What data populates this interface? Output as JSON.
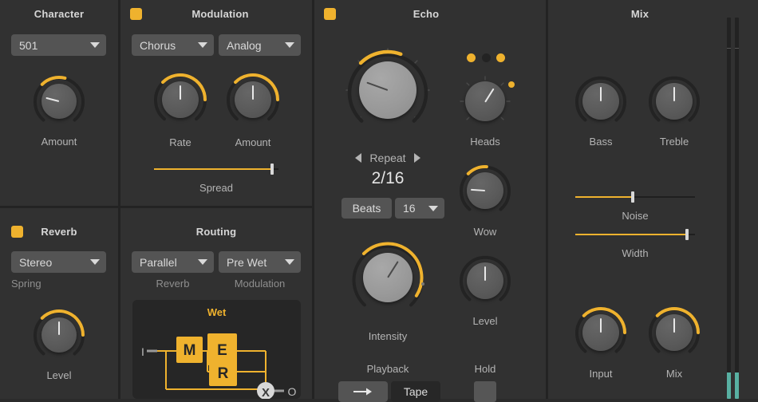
{
  "theme": {
    "background": "#313131",
    "divider": "#232323",
    "accent": "#efb22e",
    "meter": "#58b0a2",
    "knob_cap": "#5a5a5a",
    "text": "#c8c8c8"
  },
  "character": {
    "title": "Character",
    "model_select": {
      "value": "501"
    },
    "amount_knob": {
      "label": "Amount",
      "value": 0.22
    }
  },
  "modulation": {
    "title": "Modulation",
    "enabled": true,
    "type_select": {
      "value": "Chorus"
    },
    "mode_select": {
      "value": "Analog"
    },
    "rate_knob": {
      "label": "Rate",
      "value": 0.5
    },
    "amount_knob": {
      "label": "Amount",
      "value": 0.5
    },
    "spread_slider": {
      "label": "Spread",
      "value": 0.95
    }
  },
  "reverb": {
    "title": "Reverb",
    "enabled": true,
    "mode_select": {
      "value": "Stereo"
    },
    "type_label": "Spring",
    "level_knob": {
      "label": "Level",
      "value": 0.5
    }
  },
  "routing": {
    "title": "Routing",
    "reverb_select": {
      "value": "Parallel"
    },
    "reverb_caption": "Reverb",
    "modulation_select": {
      "value": "Pre Wet"
    },
    "modulation_caption": "Modulation",
    "graph": {
      "title": "Wet",
      "input_label": "I",
      "output_label": "O",
      "nodes": [
        {
          "id": "M",
          "label": "M"
        },
        {
          "id": "E",
          "label": "E"
        },
        {
          "id": "R",
          "label": "R"
        }
      ],
      "mix_node_label": "X"
    }
  },
  "echo": {
    "title": "Echo",
    "enabled": true,
    "time_knob": {
      "value": 0.24
    },
    "repeat_stepper": {
      "label": "Repeat",
      "prev_icon": "triangle-left-icon",
      "next_icon": "triangle-right-icon"
    },
    "time_value": "2/16",
    "beats_button": {
      "label": "Beats"
    },
    "division_select": {
      "value": "16"
    },
    "heads_knob": {
      "label": "Heads",
      "value": 0.62
    },
    "head_leds": [
      "on",
      "off",
      "on"
    ],
    "wow_knob": {
      "label": "Wow",
      "value": 0.18
    },
    "intensity_knob": {
      "label": "Intensity",
      "value": 0.62
    },
    "level_knob": {
      "label": "Level",
      "value": 0.5
    },
    "playback_label": "Playback",
    "playback_direction_button": {
      "icon": "arrow-right-icon"
    },
    "playback_mode_button": {
      "label": "Tape"
    },
    "hold_label": "Hold",
    "hold_checkbox": {
      "checked": false
    }
  },
  "mix": {
    "title": "Mix",
    "bass_knob": {
      "label": "Bass",
      "value": 0.5
    },
    "treble_knob": {
      "label": "Treble",
      "value": 0.5
    },
    "noise_slider": {
      "label": "Noise",
      "value": 0.48
    },
    "width_slider": {
      "label": "Width",
      "value": 0.93
    },
    "input_knob": {
      "label": "Input",
      "value": 0.5
    },
    "mix_knob": {
      "label": "Mix",
      "value": 0.5
    },
    "meters": [
      {
        "name": "meter-left",
        "level": 0.07
      },
      {
        "name": "meter-right",
        "level": 0.07
      }
    ]
  }
}
